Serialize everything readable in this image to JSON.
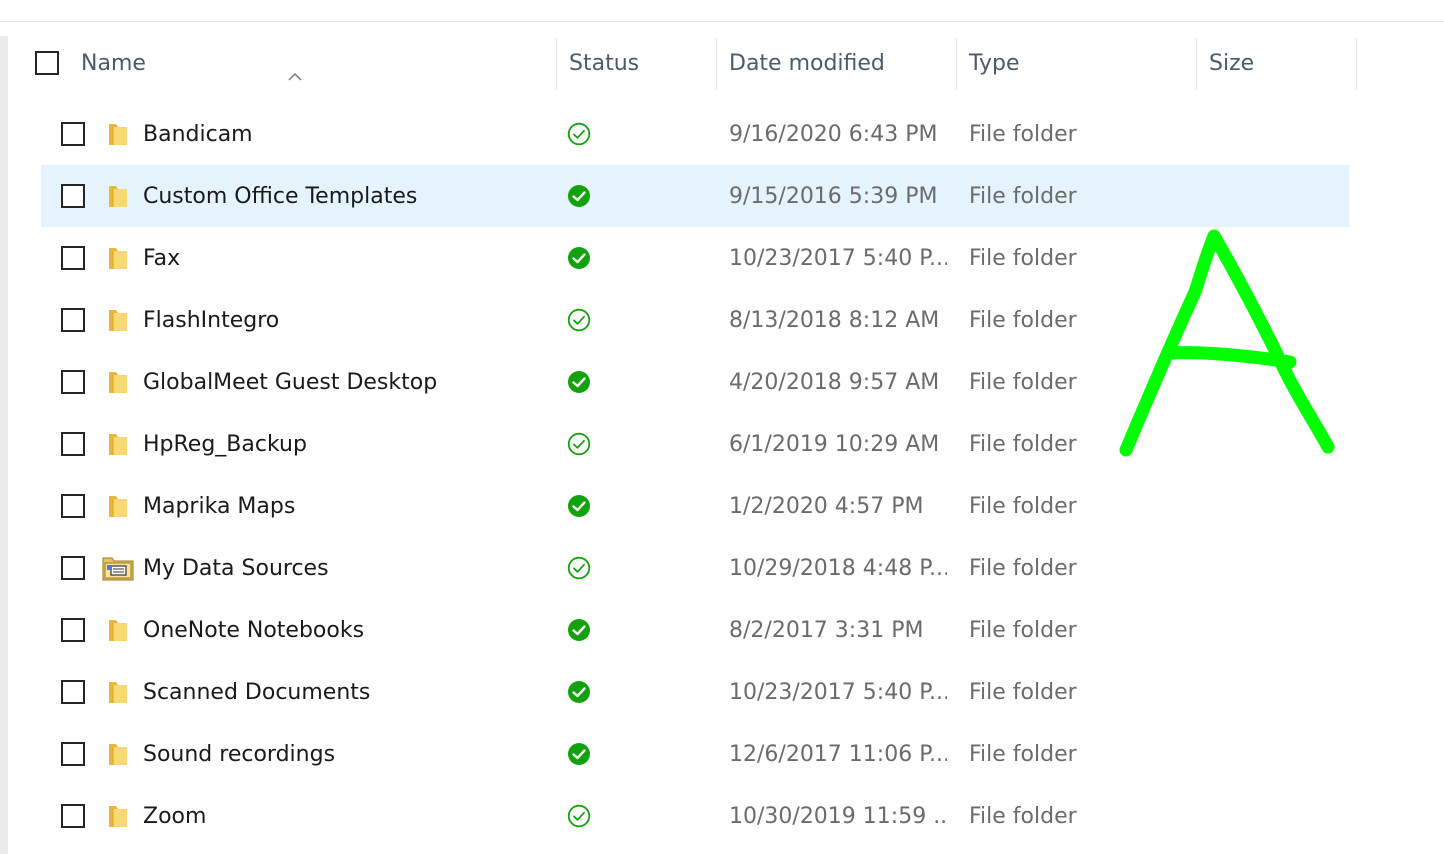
{
  "header": {
    "name": "Name",
    "status": "Status",
    "date_modified": "Date modified",
    "type": "Type",
    "size": "Size"
  },
  "colors": {
    "selected_row": "#e5f3fd",
    "status_green": "#13a10e",
    "annotation_green": "#00ff00",
    "folder_yellow": "#f8d775"
  },
  "files": [
    {
      "name": "Bandicam",
      "status": "available-online-icon",
      "date": "9/16/2020 6:43 PM",
      "type": "File folder",
      "icon": "folder-icon",
      "selected": false
    },
    {
      "name": "Custom Office Templates",
      "status": "always-available-icon",
      "date": "9/15/2016 5:39 PM",
      "type": "File folder",
      "icon": "folder-icon",
      "selected": true
    },
    {
      "name": "Fax",
      "status": "always-available-icon",
      "date": "10/23/2017 5:40 P...",
      "type": "File folder",
      "icon": "folder-icon",
      "selected": false
    },
    {
      "name": "FlashIntegro",
      "status": "available-online-icon",
      "date": "8/13/2018 8:12 AM",
      "type": "File folder",
      "icon": "folder-icon",
      "selected": false
    },
    {
      "name": "GlobalMeet Guest Desktop",
      "status": "always-available-icon",
      "date": "4/20/2018 9:57 AM",
      "type": "File folder",
      "icon": "folder-icon",
      "selected": false
    },
    {
      "name": "HpReg_Backup",
      "status": "available-online-icon",
      "date": "6/1/2019 10:29 AM",
      "type": "File folder",
      "icon": "folder-icon",
      "selected": false
    },
    {
      "name": "Maprika Maps",
      "status": "always-available-icon",
      "date": "1/2/2020 4:57 PM",
      "type": "File folder",
      "icon": "folder-icon",
      "selected": false
    },
    {
      "name": "My Data Sources",
      "status": "available-online-icon",
      "date": "10/29/2018 4:48 P...",
      "type": "File folder",
      "icon": "data-sources-folder-icon",
      "selected": false
    },
    {
      "name": "OneNote Notebooks",
      "status": "always-available-icon",
      "date": "8/2/2017 3:31 PM",
      "type": "File folder",
      "icon": "folder-icon",
      "selected": false
    },
    {
      "name": "Scanned Documents",
      "status": "always-available-icon",
      "date": "10/23/2017 5:40 P...",
      "type": "File folder",
      "icon": "folder-icon",
      "selected": false
    },
    {
      "name": "Sound recordings",
      "status": "always-available-icon",
      "date": "12/6/2017 11:06 P...",
      "type": "File folder",
      "icon": "folder-icon",
      "selected": false
    },
    {
      "name": "Zoom",
      "status": "available-online-icon",
      "date": "10/30/2019 11:59 ...",
      "type": "File folder",
      "icon": "folder-icon",
      "selected": false
    }
  ],
  "annotation": {
    "icon": "handwritten-letter-a"
  }
}
